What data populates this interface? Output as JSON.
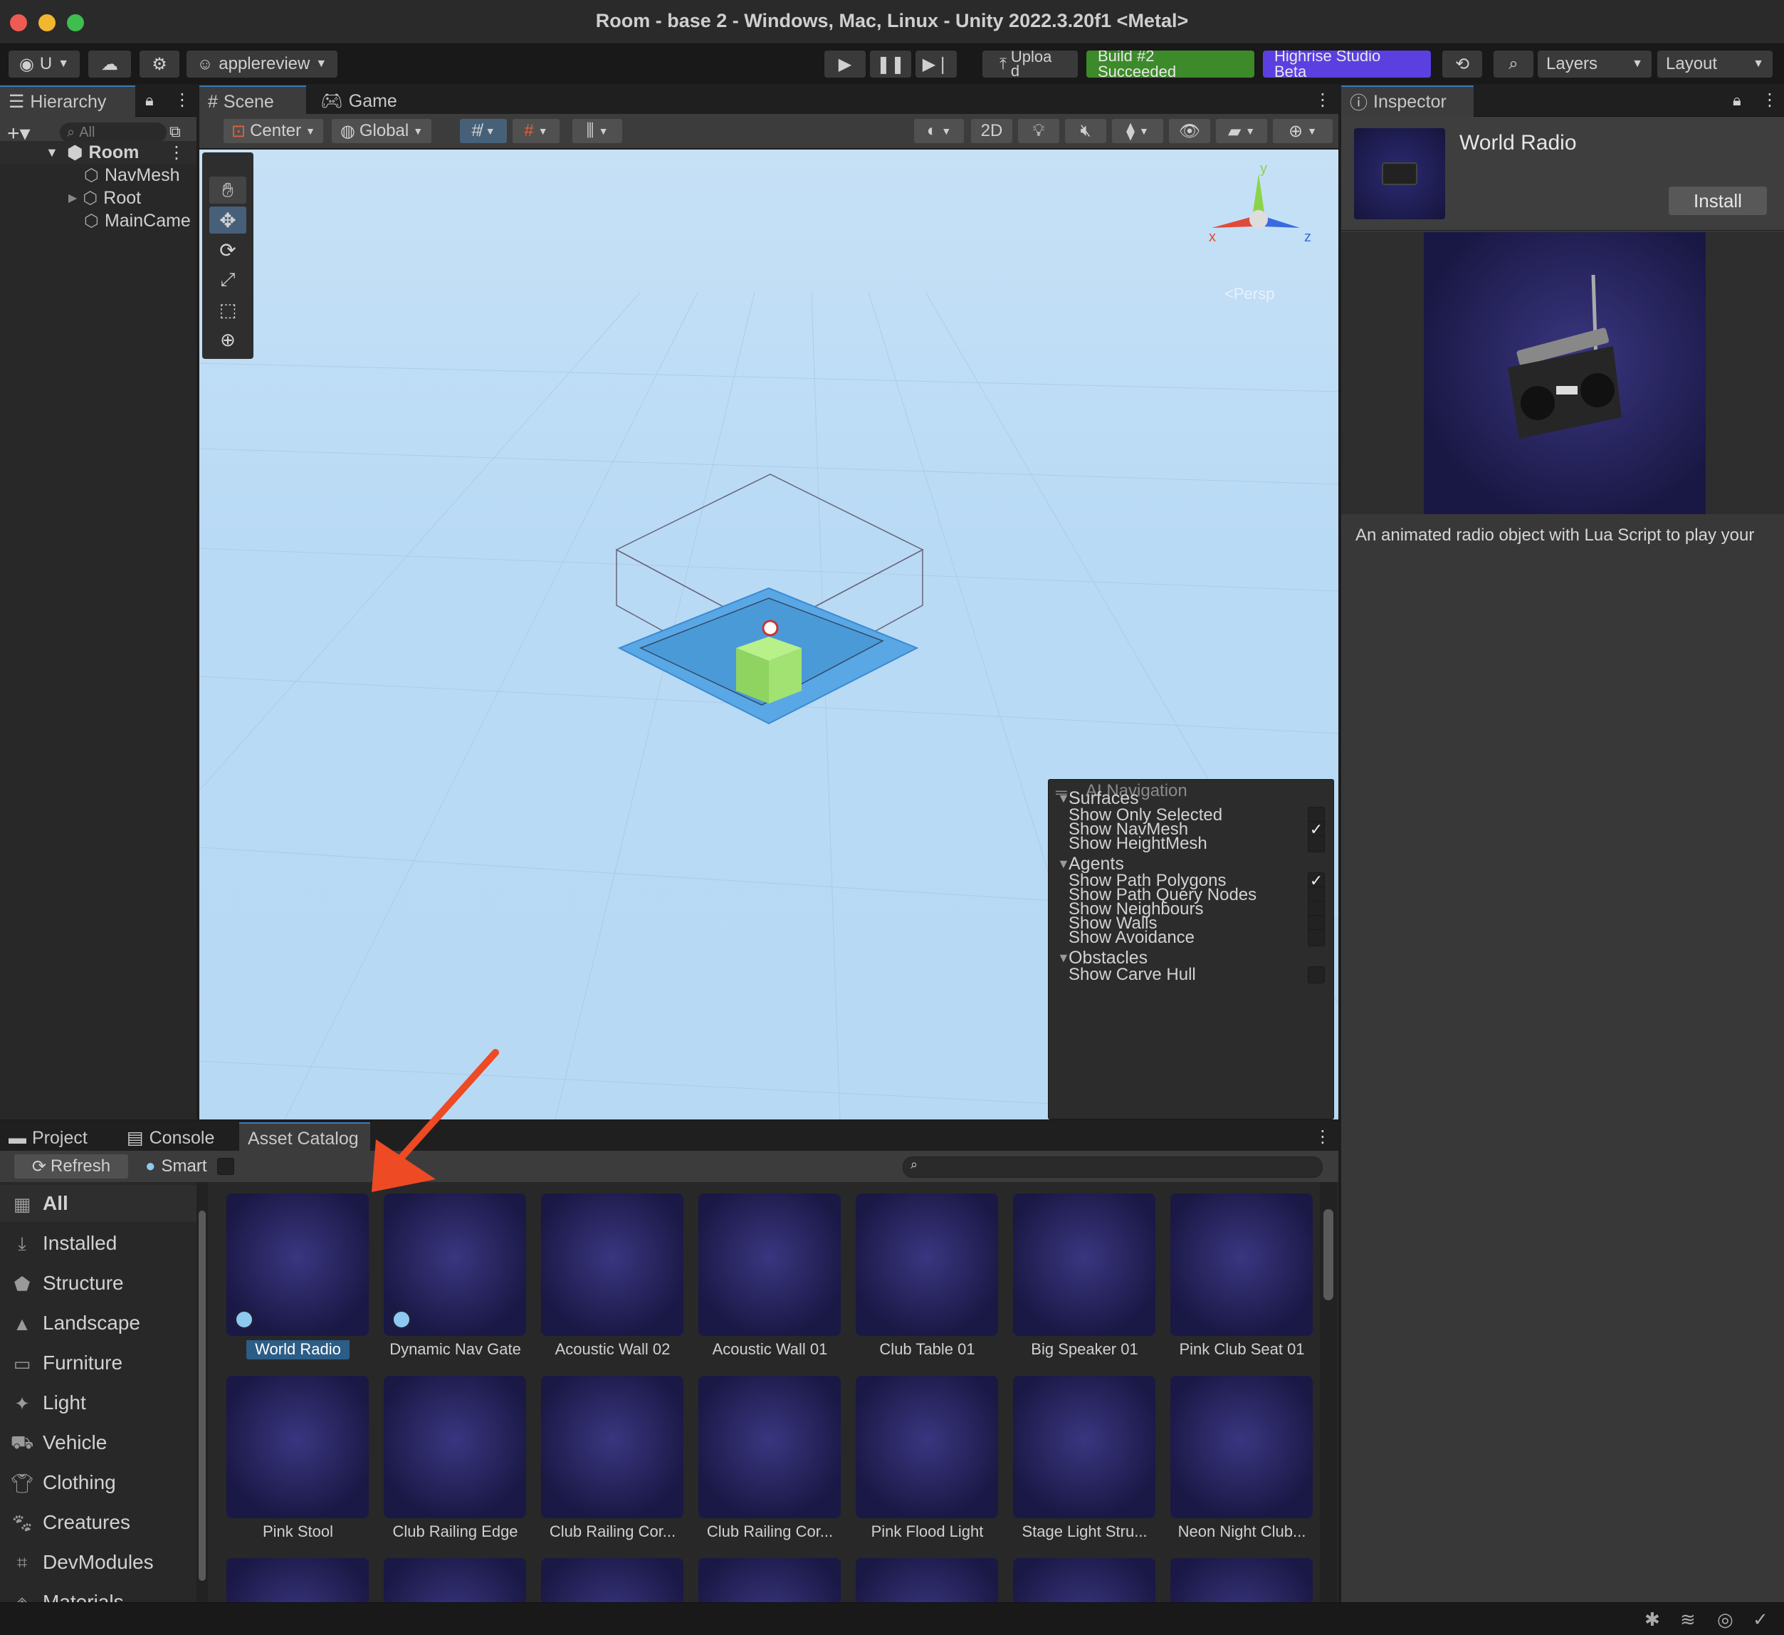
{
  "window": {
    "title": "Room - base 2 - Windows, Mac, Linux - Unity 2022.3.20f1 <Metal>"
  },
  "toolbar": {
    "account": "U",
    "user": "applereview",
    "upload": "Uploa d",
    "build_status": "Build #2 Succeeded",
    "studio": "Highrise Studio Beta",
    "layers": "Layers",
    "layout": "Layout"
  },
  "hierarchy": {
    "tab": "Hierarchy",
    "search_placeholder": "All",
    "root": "Room",
    "items": [
      "NavMesh",
      "Root",
      "MainCame"
    ]
  },
  "scene": {
    "tabs": [
      "Scene",
      "Game"
    ],
    "pivot": "Center",
    "space": "Global",
    "mode_2d": "2D",
    "gizmo": {
      "x": "x",
      "y": "y",
      "z": "z",
      "persp": "<Persp"
    }
  },
  "ai_navigation": {
    "title": "AI Navigation",
    "sections": [
      {
        "name": "Surfaces",
        "items": [
          {
            "label": "Show Only Selected",
            "checked": false
          },
          {
            "label": "Show NavMesh",
            "checked": true
          },
          {
            "label": "Show HeightMesh",
            "checked": false
          }
        ]
      },
      {
        "name": "Agents",
        "items": [
          {
            "label": "Show Path Polygons",
            "checked": true
          },
          {
            "label": "Show Path Query Nodes",
            "checked": false
          },
          {
            "label": "Show Neighbours",
            "checked": false
          },
          {
            "label": "Show Walls",
            "checked": false
          },
          {
            "label": "Show Avoidance",
            "checked": false
          }
        ]
      },
      {
        "name": "Obstacles",
        "items": [
          {
            "label": "Show Carve Hull",
            "checked": false
          }
        ]
      }
    ]
  },
  "inspector": {
    "tab": "Inspector",
    "asset_name": "World Radio",
    "install_button": "Install",
    "description": "An animated radio object with Lua Script to play your"
  },
  "bottom": {
    "tabs": [
      "Project",
      "Console",
      "Asset Catalog"
    ],
    "refresh": "Refresh",
    "smart": "Smart",
    "categories": [
      {
        "label": "All",
        "icon": "grid-icon"
      },
      {
        "label": "Installed",
        "icon": "download-icon"
      },
      {
        "label": "Structure",
        "icon": "structure-icon"
      },
      {
        "label": "Landscape",
        "icon": "mountain-icon"
      },
      {
        "label": "Furniture",
        "icon": "sofa-icon"
      },
      {
        "label": "Light",
        "icon": "sparkle-icon"
      },
      {
        "label": "Vehicle",
        "icon": "car-icon"
      },
      {
        "label": "Clothing",
        "icon": "shirt-icon"
      },
      {
        "label": "Creatures",
        "icon": "creature-icon"
      },
      {
        "label": "DevModules",
        "icon": "code-icon"
      },
      {
        "label": "Materials",
        "icon": "material-icon"
      }
    ],
    "assets_row1": [
      "World Radio",
      "Dynamic Nav Gate",
      "Acoustic Wall 02",
      "Acoustic Wall 01",
      "Club Table 01",
      "Big Speaker 01",
      "Pink Club Seat 01"
    ],
    "assets_row2": [
      "Pink Stool",
      "Club Railing Edge",
      "Club Railing Cor...",
      "Club Railing Cor...",
      "Pink Flood Light",
      "Stage Light Stru...",
      "Neon Night Club..."
    ]
  },
  "colors": {
    "accent": "#3a79bb",
    "build_green": "#3c8a2a",
    "studio_purple": "#5b3fe0",
    "annotation_arrow": "#ee4a24"
  }
}
